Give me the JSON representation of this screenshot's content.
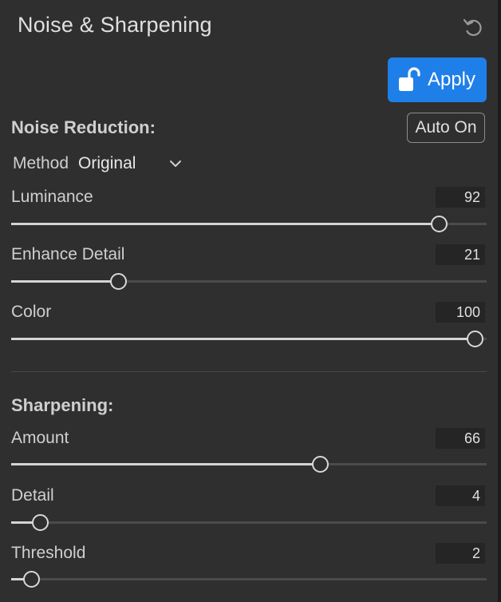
{
  "panel": {
    "title": "Noise & Sharpening",
    "reset_icon": "undo-icon"
  },
  "apply": {
    "label": "Apply",
    "icon": "unlock-icon",
    "color": "#1f7fe8"
  },
  "noise_reduction": {
    "title": "Noise Reduction:",
    "auto_label": "Auto On",
    "method_label": "Method",
    "method_value": "Original",
    "sliders": {
      "luminance": {
        "label": "Luminance",
        "value": "92",
        "fraction": 0.9
      },
      "enhance_detail": {
        "label": "Enhance Detail",
        "value": "21",
        "fraction": 0.225
      },
      "color": {
        "label": "Color",
        "value": "100",
        "fraction": 0.975
      }
    }
  },
  "sharpening": {
    "title": "Sharpening:",
    "sliders": {
      "amount": {
        "label": "Amount",
        "value": "66",
        "fraction": 0.65
      },
      "detail": {
        "label": "Detail",
        "value": "4",
        "fraction": 0.06
      },
      "threshold": {
        "label": "Threshold",
        "value": "2",
        "fraction": 0.042
      }
    }
  }
}
